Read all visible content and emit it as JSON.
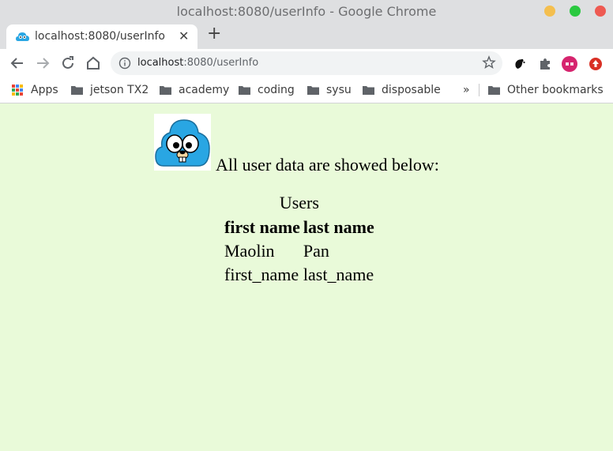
{
  "window": {
    "title": "localhost:8080/userInfo - Google Chrome",
    "controls": [
      "minimize",
      "maximize",
      "close"
    ],
    "control_colors": [
      "#f4bf4f",
      "#2ac940",
      "#ee5a52"
    ]
  },
  "tab": {
    "title": "localhost:8080/userInfo",
    "favicon": "gopher-icon"
  },
  "address_bar": {
    "host": "localhost",
    "path": ":8080/userInfo"
  },
  "bookmarks": {
    "apps_label": "Apps",
    "items": [
      "jetson TX2",
      "academy",
      "coding",
      "sysu",
      "disposable"
    ],
    "overflow": "»",
    "other": "Other bookmarks"
  },
  "page": {
    "background": "#e9fad9",
    "intro_text": "All user data are showed below:",
    "table": {
      "caption": "Users",
      "headers": [
        "first name",
        "last name"
      ],
      "rows": [
        [
          "Maolin",
          "Pan"
        ],
        [
          "first_name",
          "last_name"
        ]
      ]
    }
  }
}
